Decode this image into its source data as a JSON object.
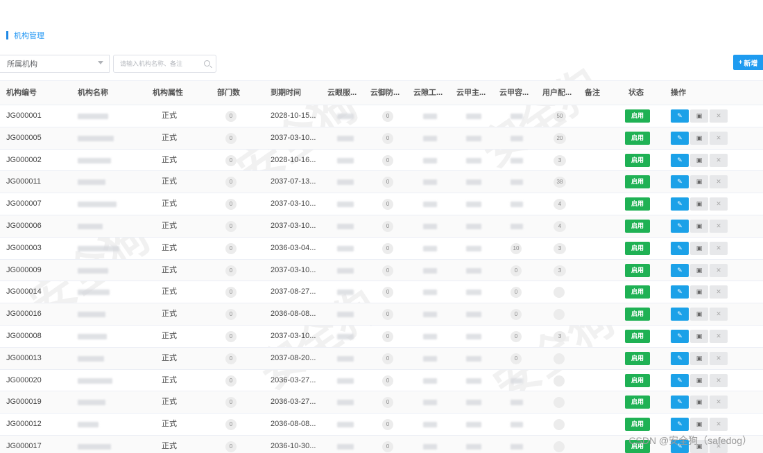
{
  "page": {
    "title": "机构管理"
  },
  "toolbar": {
    "org_select": "所属机构",
    "search_placeholder": "请输入机构名称、备注",
    "add_label": "新增",
    "add_icon": "plus-icon"
  },
  "columns": {
    "code": "机构编号",
    "name": "机构名称",
    "attr": "机构属性",
    "dept_count": "部门数",
    "expire": "到期时间",
    "c1": "云眼服...",
    "c2": "云御防...",
    "c3": "云隙工...",
    "c4": "云甲主...",
    "c5": "云甲容...",
    "c6": "用户配...",
    "remark": "备注",
    "status": "状态",
    "ops": "操作"
  },
  "rows": [
    {
      "code": "JG000001",
      "attr": "正式",
      "dept": "0",
      "expire": "2028-10-15...",
      "c2": "0",
      "c5": "",
      "c6": "50",
      "status": "启用"
    },
    {
      "code": "JG000005",
      "attr": "正式",
      "dept": "0",
      "expire": "2037-03-10...",
      "c2": "0",
      "c5": "",
      "c6": "20",
      "status": "启用"
    },
    {
      "code": "JG000002",
      "attr": "正式",
      "dept": "0",
      "expire": "2028-10-16...",
      "c2": "0",
      "c5": "",
      "c6": "3",
      "status": "启用"
    },
    {
      "code": "JG000011",
      "attr": "正式",
      "dept": "0",
      "expire": "2037-07-13...",
      "c2": "0",
      "c5": "",
      "c6": "38",
      "status": "启用"
    },
    {
      "code": "JG000007",
      "attr": "正式",
      "dept": "0",
      "expire": "2037-03-10...",
      "c2": "0",
      "c5": "",
      "c6": "4",
      "status": "启用"
    },
    {
      "code": "JG000006",
      "attr": "正式",
      "dept": "0",
      "expire": "2037-03-10...",
      "c2": "0",
      "c5": "",
      "c6": "4",
      "status": "启用"
    },
    {
      "code": "JG000003",
      "attr": "正式",
      "dept": "0",
      "expire": "2036-03-04...",
      "c2": "0",
      "c5": "10",
      "c6": "3",
      "status": "启用"
    },
    {
      "code": "JG000009",
      "attr": "正式",
      "dept": "0",
      "expire": "2037-03-10...",
      "c2": "0",
      "c5": "0",
      "c6": "3",
      "status": "启用"
    },
    {
      "code": "JG000014",
      "attr": "正式",
      "dept": "0",
      "expire": "2037-08-27...",
      "c2": "0",
      "c5": "0",
      "c6": "",
      "status": "启用"
    },
    {
      "code": "JG000016",
      "attr": "正式",
      "dept": "0",
      "expire": "2036-08-08...",
      "c2": "0",
      "c5": "0",
      "c6": "",
      "status": "启用"
    },
    {
      "code": "JG000008",
      "attr": "正式",
      "dept": "0",
      "expire": "2037-03-10...",
      "c2": "0",
      "c5": "0",
      "c6": "3",
      "status": "启用"
    },
    {
      "code": "JG000013",
      "attr": "正式",
      "dept": "0",
      "expire": "2037-08-20...",
      "c2": "0",
      "c5": "0",
      "c6": "",
      "status": "启用"
    },
    {
      "code": "JG000020",
      "attr": "正式",
      "dept": "0",
      "expire": "2036-03-27...",
      "c2": "0",
      "c5": "",
      "c6": "",
      "status": "启用"
    },
    {
      "code": "JG000019",
      "attr": "正式",
      "dept": "0",
      "expire": "2036-03-27...",
      "c2": "0",
      "c5": "",
      "c6": "",
      "status": "启用"
    },
    {
      "code": "JG000012",
      "attr": "正式",
      "dept": "0",
      "expire": "2036-08-08...",
      "c2": "0",
      "c5": "",
      "c6": "",
      "status": "启用"
    },
    {
      "code": "JG000017",
      "attr": "正式",
      "dept": "0",
      "expire": "2036-10-30...",
      "c2": "0",
      "c5": "",
      "c6": "",
      "status": "启用"
    }
  ],
  "row_actions": {
    "edit_icon": "edit-icon",
    "lock_icon": "lock-icon",
    "delete_icon": "trash-icon"
  },
  "watermark": {
    "text": "安全狗",
    "sub": "忠诚守护 值得信赖",
    "credit": "CSDN @安全狗（safedog）"
  },
  "colors": {
    "accent": "#1e9bf0",
    "status_green": "#1fb154"
  }
}
